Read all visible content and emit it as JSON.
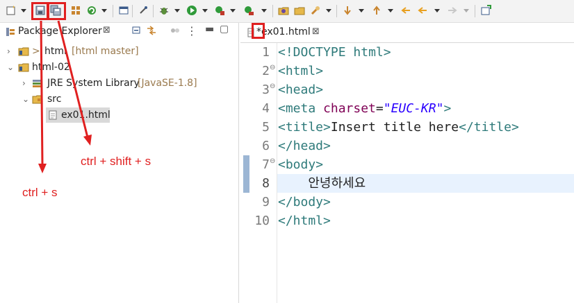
{
  "toolbar": {
    "icons": [
      "new-icon",
      "save-icon",
      "save-all-icon",
      "build-icon",
      "refresh-icon",
      "console-icon",
      "pin-icon",
      "debug-icon",
      "run-icon",
      "coverage-icon",
      "external-tools-icon",
      "open-type-icon",
      "open-folder-icon",
      "search-icon",
      "next-annotation-icon",
      "prev-annotation-icon",
      "last-edit-icon",
      "back-icon",
      "forward-icon",
      "open-perspective-icon"
    ]
  },
  "left_panel": {
    "title": "Package Explorer",
    "close": "⊠",
    "tree": [
      {
        "label": "html",
        "decoration": "[html master]",
        "prefix": ">",
        "level": 0,
        "expanded": false
      },
      {
        "label": "html-02",
        "decoration": "",
        "prefix": "",
        "level": 0,
        "expanded": true
      },
      {
        "label": "JRE System Library",
        "decoration": "[JavaSE-1.8]",
        "prefix": "",
        "level": 1,
        "expanded": false
      },
      {
        "label": "src",
        "decoration": "",
        "prefix": "",
        "level": 1,
        "expanded": true
      },
      {
        "label": "ex01.html",
        "decoration": "",
        "prefix": "",
        "level": 2,
        "selected": true
      }
    ]
  },
  "editor": {
    "tab_label": "*ex01.html",
    "tab_close": "⊠",
    "lines": [
      {
        "n": "1",
        "code": "<!DOCTYPE html>"
      },
      {
        "n": "2",
        "code": "<html>"
      },
      {
        "n": "3",
        "code": "<head>"
      },
      {
        "n": "4",
        "code": "<meta charset=\"EUC-KR\">"
      },
      {
        "n": "5",
        "code": "<title>Insert title here</title>"
      },
      {
        "n": "6",
        "code": "</head>"
      },
      {
        "n": "7",
        "code": "<body>"
      },
      {
        "n": "8",
        "code": "    안녕하세요"
      },
      {
        "n": "9",
        "code": "</body>"
      },
      {
        "n": "10",
        "code": "</html>"
      }
    ],
    "current_line": 8
  },
  "annotations": {
    "save_shortcut": "ctrl + s",
    "save_all_shortcut": "ctrl + shift + s"
  },
  "colors": {
    "annotation": "#e02020",
    "tag": "#2e7a7a",
    "attr": "#7f0055",
    "value": "#2a00ff"
  }
}
